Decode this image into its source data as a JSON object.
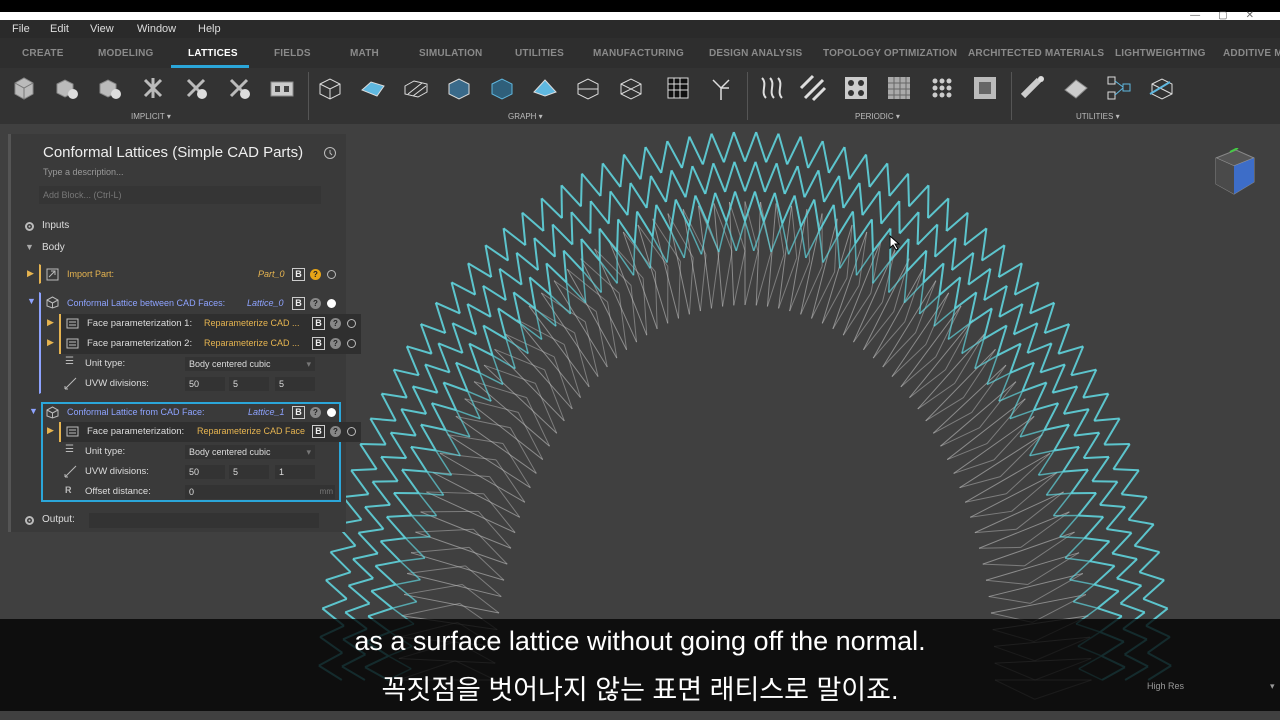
{
  "menu": [
    "File",
    "Edit",
    "View",
    "Window",
    "Help"
  ],
  "tabs": [
    "CREATE",
    "MODELING",
    "LATTICES",
    "FIELDS",
    "MATH",
    "SIMULATION",
    "UTILITIES",
    "MANUFACTURING",
    "DESIGN ANALYSIS",
    "TOPOLOGY OPTIMIZATION",
    "ARCHITECTED MATERIALS",
    "LIGHTWEIGHTING",
    "ADDITIVE MA"
  ],
  "active_tab": "LATTICES",
  "toolbar_groups": [
    "IMPLICIT",
    "GRAPH",
    "PERIODIC",
    "UTILITIES"
  ],
  "panel": {
    "title": "Conformal Lattices (Simple CAD Parts)",
    "description_placeholder": "Type a description...",
    "add_block_placeholder": "Add Block... (Ctrl-L)",
    "inputs_label": "Inputs",
    "body_label": "Body",
    "output_label": "Output:",
    "blocks": [
      {
        "name": "Import Part:",
        "var": "Part_0"
      },
      {
        "name": "Conformal Lattice between CAD Faces:",
        "var": "Lattice_0",
        "params": [
          {
            "label": "Face parameterization 1:",
            "value": "Reparameterize CAD ..."
          },
          {
            "label": "Face parameterization 2:",
            "value": "Reparameterize CAD ..."
          },
          {
            "label": "Unit type:",
            "value": "Body centered cubic"
          },
          {
            "label": "UVW divisions:",
            "values": [
              "50",
              "5",
              "5"
            ]
          }
        ]
      },
      {
        "name": "Conformal Lattice from CAD Face:",
        "var": "Lattice_1",
        "params": [
          {
            "label": "Face parameterization:",
            "value": "Reparameterize CAD Face"
          },
          {
            "label": "Unit type:",
            "value": "Body centered cubic"
          },
          {
            "label": "UVW divisions:",
            "values": [
              "50",
              "5",
              "1"
            ]
          },
          {
            "label": "Offset distance:",
            "value": "0",
            "unit": "mm"
          }
        ]
      }
    ],
    "badge_b": "B",
    "badge_q": "?"
  },
  "subtitles": {
    "en": "as a surface lattice without going off the normal.",
    "ko": "꼭짓점을 벗어나지 않는 표면 래티스로 말이죠."
  },
  "render_quality": "High Res",
  "colors": {
    "accent": "#2ba6d9",
    "lattice_cyan": "#5fd3dc",
    "lattice_grey": "#c8c8c8"
  }
}
